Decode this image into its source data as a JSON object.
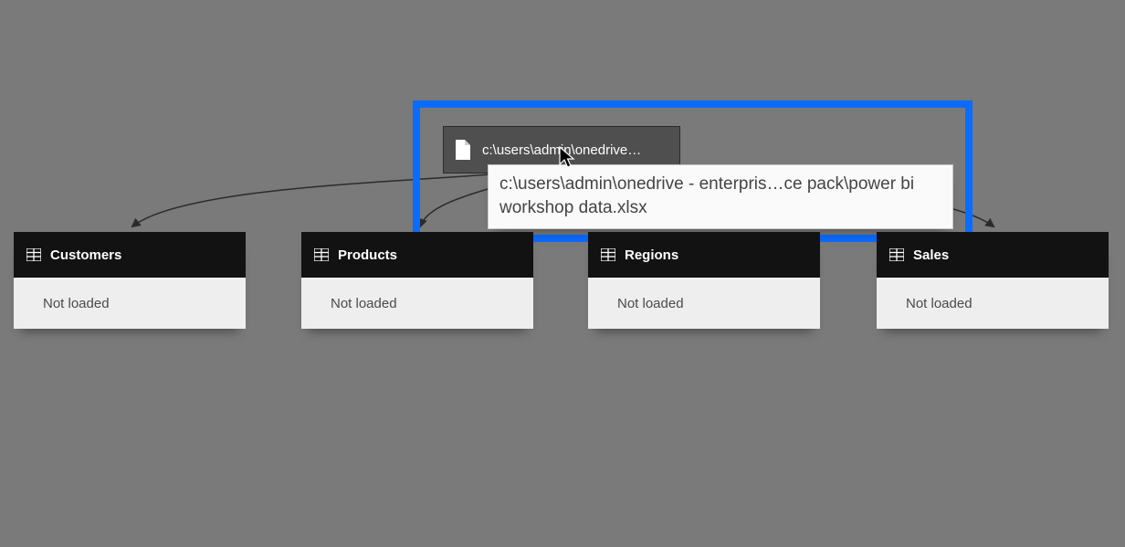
{
  "source": {
    "short_label": "c:\\users\\admin\\onedrive…",
    "tooltip": "c:\\users\\admin\\onedrive - enterpris…ce pack\\power bi workshop data.xlsx"
  },
  "tables": {
    "customers": {
      "name": "Customers",
      "status": "Not loaded"
    },
    "products": {
      "name": "Products",
      "status": "Not loaded"
    },
    "regions": {
      "name": "Regions",
      "status": "Not loaded"
    },
    "sales": {
      "name": "Sales",
      "status": "Not loaded"
    }
  }
}
